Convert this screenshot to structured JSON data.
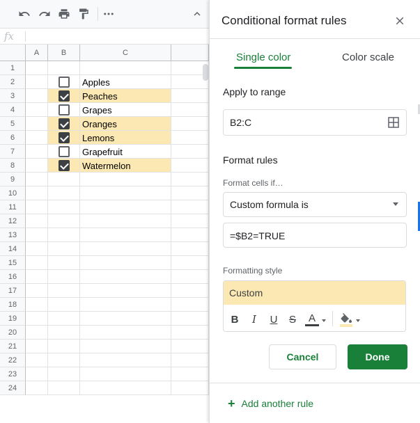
{
  "formula_bar": {
    "fx_symbol": "fx"
  },
  "columns": [
    "A",
    "B",
    "C"
  ],
  "rows": [
    {
      "num": "1",
      "checkbox": null,
      "text": ""
    },
    {
      "num": "2",
      "checkbox": false,
      "text": "Apples"
    },
    {
      "num": "3",
      "checkbox": true,
      "text": "Peaches"
    },
    {
      "num": "4",
      "checkbox": false,
      "text": "Grapes"
    },
    {
      "num": "5",
      "checkbox": true,
      "text": "Oranges"
    },
    {
      "num": "6",
      "checkbox": true,
      "text": "Lemons"
    },
    {
      "num": "7",
      "checkbox": false,
      "text": "Grapefruit"
    },
    {
      "num": "8",
      "checkbox": true,
      "text": "Watermelon"
    },
    {
      "num": "9",
      "checkbox": null,
      "text": ""
    },
    {
      "num": "10",
      "checkbox": null,
      "text": ""
    },
    {
      "num": "11",
      "checkbox": null,
      "text": ""
    },
    {
      "num": "12",
      "checkbox": null,
      "text": ""
    },
    {
      "num": "13",
      "checkbox": null,
      "text": ""
    },
    {
      "num": "14",
      "checkbox": null,
      "text": ""
    },
    {
      "num": "15",
      "checkbox": null,
      "text": ""
    },
    {
      "num": "16",
      "checkbox": null,
      "text": ""
    },
    {
      "num": "17",
      "checkbox": null,
      "text": ""
    },
    {
      "num": "18",
      "checkbox": null,
      "text": ""
    },
    {
      "num": "19",
      "checkbox": null,
      "text": ""
    },
    {
      "num": "20",
      "checkbox": null,
      "text": ""
    },
    {
      "num": "21",
      "checkbox": null,
      "text": ""
    },
    {
      "num": "22",
      "checkbox": null,
      "text": ""
    },
    {
      "num": "23",
      "checkbox": null,
      "text": ""
    },
    {
      "num": "24",
      "checkbox": null,
      "text": ""
    }
  ],
  "colors": {
    "highlight": "#fce8b2",
    "accent_green": "#188038",
    "header_bg": "#f8f9fa"
  },
  "toolbar": {
    "icons": [
      "undo-icon",
      "redo-icon",
      "print-icon",
      "paint-format-icon",
      "more-icon",
      "collapse-icon"
    ]
  },
  "panel": {
    "title": "Conditional format rules",
    "tabs": {
      "single": "Single color",
      "scale": "Color scale"
    },
    "apply_label": "Apply to range",
    "range_value": "B2:C",
    "format_rules_label": "Format rules",
    "format_cells_if_label": "Format cells if…",
    "condition_value": "Custom formula is",
    "formula_value": "=$B2=TRUE",
    "formatting_style_label": "Formatting style",
    "style_preview": "Custom",
    "format_buttons": {
      "bold": "B",
      "italic": "I",
      "underline": "U",
      "strike": "S",
      "text_color": "A"
    },
    "cancel_label": "Cancel",
    "done_label": "Done",
    "add_rule_label": "Add another rule",
    "add_rule_plus": "+"
  }
}
